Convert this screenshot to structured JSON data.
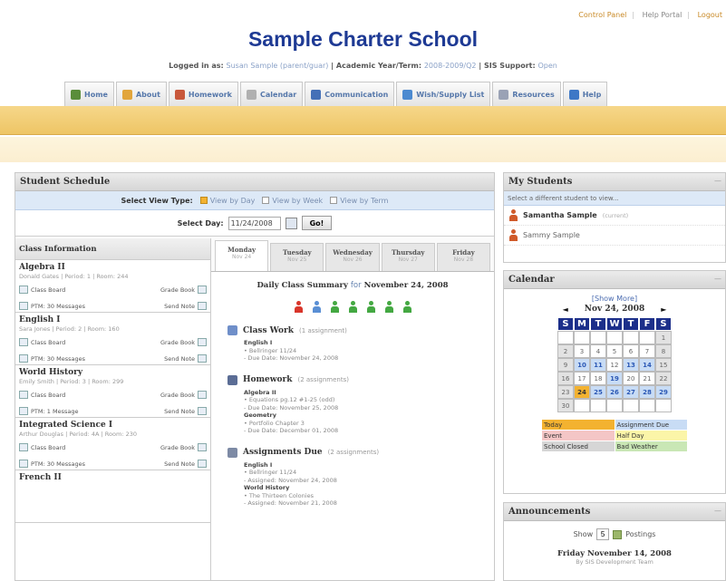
{
  "top_links": [
    "Control Panel",
    "Help Portal",
    "Logout"
  ],
  "school_name": "Sample Charter School",
  "login": {
    "label": "Logged in as:",
    "user": "Susan Sample (parent/guar)",
    "year_label": "Academic Year/Term:",
    "year": "2008-2009/Q2",
    "support_label": "SIS Support:",
    "support": "Open"
  },
  "nav": [
    {
      "label": "Home",
      "color": "#5a8d3a"
    },
    {
      "label": "About",
      "color": "#e2a53b"
    },
    {
      "label": "Homework",
      "color": "#c8573b"
    },
    {
      "label": "Calendar",
      "color": "#b0b0b0"
    },
    {
      "label": "Communication",
      "color": "#4470b7"
    },
    {
      "label": "Wish/Supply List",
      "color": "#4c8ad0"
    },
    {
      "label": "Resources",
      "color": "#9aa2b5"
    },
    {
      "label": "Help",
      "color": "#3e78c6"
    }
  ],
  "schedule": {
    "title": "Student Schedule",
    "view_type_label": "Select View Type:",
    "view_options": [
      {
        "label": "View by Day",
        "on": true
      },
      {
        "label": "View by Week",
        "on": false
      },
      {
        "label": "View by Term",
        "on": false
      }
    ],
    "select_day_label": "Select Day:",
    "day_value": "11/24/2008",
    "go": "Go!",
    "class_info_header": "Class Information",
    "classes": [
      {
        "name": "Algebra II",
        "meta": "Donald Gates | Period: 1 | Room: 244",
        "board": "Class Board",
        "grade": "Grade Book",
        "ptm": "PTM: 30 Messages",
        "send": "Send Note"
      },
      {
        "name": "English I",
        "meta": "Sara Jones | Period: 2 | Room: 160",
        "board": "Class Board",
        "grade": "Grade Book",
        "ptm": "PTM: 30 Messages",
        "send": "Send Note"
      },
      {
        "name": "World History",
        "meta": "Emily Smith | Period: 3 | Room: 299",
        "board": "Class Board",
        "grade": "Grade Book",
        "ptm": "PTM: 1 Message",
        "send": "Send Note"
      },
      {
        "name": "Integrated Science I",
        "meta": "Arthur Douglas | Period: 4A | Room: 230",
        "board": "Class Board",
        "grade": "Grade Book",
        "ptm": "PTM: 30 Messages",
        "send": "Send Note"
      },
      {
        "name": "French II",
        "meta": "",
        "board": "",
        "grade": "",
        "ptm": "",
        "send": ""
      }
    ],
    "day_tabs": [
      {
        "day": "Monday",
        "date": "Nov 24",
        "on": true
      },
      {
        "day": "Tuesday",
        "date": "Nov 25",
        "on": false
      },
      {
        "day": "Wednesday",
        "date": "Nov 26",
        "on": false
      },
      {
        "day": "Thursday",
        "date": "Nov 27",
        "on": false
      },
      {
        "day": "Friday",
        "date": "Nov 28",
        "on": false
      }
    ],
    "summary_prefix": "Daily Class Summary",
    "summary_for": "for",
    "summary_date": "November 24, 2008",
    "people_colors": [
      "#d9362b",
      "#5a8fd4",
      "#44a842",
      "#44a842",
      "#44a842",
      "#44a842",
      "#44a842"
    ],
    "sections": [
      {
        "title": "Class Work",
        "count": "(1 assignment)",
        "color": "#6f8fc9",
        "lines": [
          {
            "t": "English I",
            "subj": true
          },
          {
            "t": "• Bellringer 11/24"
          },
          {
            "t": "- Due Date: November 24, 2008"
          }
        ]
      },
      {
        "title": "Homework",
        "count": "(2 assignments)",
        "color": "#5b6d95",
        "lines": [
          {
            "t": "Algebra II",
            "subj": true
          },
          {
            "t": "• Equations pg.12 #1-25 (odd)"
          },
          {
            "t": "- Due Date: November 25, 2008"
          },
          {
            "t": "Geometry",
            "subj": true
          },
          {
            "t": "• Portfolio Chapter 3"
          },
          {
            "t": "- Due Date: December 01, 2008"
          }
        ]
      },
      {
        "title": "Assignments Due",
        "count": "(2 assignments)",
        "color": "#7d8aa5",
        "lines": [
          {
            "t": "English I",
            "subj": true
          },
          {
            "t": "• Bellringer 11/24"
          },
          {
            "t": "- Assigned: November 24, 2008"
          },
          {
            "t": "World History",
            "subj": true
          },
          {
            "t": "• The Thirteen Colonies"
          },
          {
            "t": "- Assigned: November 21, 2008"
          }
        ]
      }
    ]
  },
  "students": {
    "title": "My Students",
    "hint": "Select a different student to view...",
    "list": [
      {
        "name": "Samantha Sample",
        "note": "(current)"
      },
      {
        "name": "Sammy Sample",
        "note": ""
      }
    ]
  },
  "calendar": {
    "title": "Calendar",
    "show_more": "[Show More]",
    "month": "Nov 24, 2008",
    "prev": "◄",
    "next": "►",
    "weekdays": [
      "S",
      "M",
      "T",
      "W",
      "T",
      "F",
      "S"
    ],
    "days": [
      "",
      "",
      "",
      "",
      "",
      "",
      "1",
      "2",
      "3",
      "4",
      "5",
      "6",
      "7",
      "8",
      "9",
      "10",
      "11",
      "12",
      "13",
      "14",
      "15",
      "16",
      "17",
      "18",
      "19",
      "20",
      "21",
      "22",
      "23",
      "24",
      "25",
      "26",
      "27",
      "28",
      "29",
      "30",
      "",
      "",
      "",
      "",
      "",
      ""
    ],
    "assign_days": [
      "10",
      "11",
      "13",
      "14",
      "19",
      "25",
      "26",
      "27",
      "28",
      "29"
    ],
    "today": "24",
    "legend": [
      {
        "label": "Today",
        "color": "#f3b230"
      },
      {
        "label": "Assignment Due",
        "color": "#c8dcf5"
      },
      {
        "label": "Event",
        "color": "#f4c6c6"
      },
      {
        "label": "Half Day",
        "color": "#fbf5a8"
      },
      {
        "label": "School Closed",
        "color": "#d6d6d6"
      },
      {
        "label": "Bad Weather",
        "color": "#c9e7b5"
      }
    ]
  },
  "announcements": {
    "title": "Announcements",
    "show": "Show",
    "count": "5",
    "postings": "Postings",
    "date": "Friday November 14, 2008",
    "by": "By SIS Development Team"
  }
}
